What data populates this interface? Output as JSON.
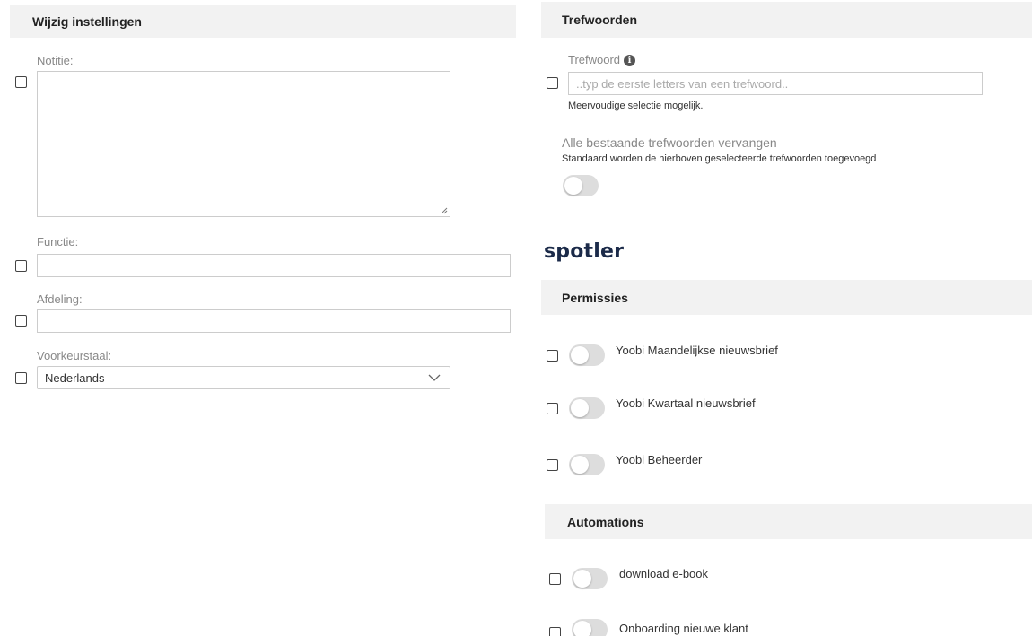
{
  "left": {
    "header": "Wijzig instellingen",
    "notitie": {
      "label": "Notitie:",
      "value": ""
    },
    "functie": {
      "label": "Functie:",
      "value": ""
    },
    "afdeling": {
      "label": "Afdeling:",
      "value": ""
    },
    "voorkeurstaal": {
      "label": "Voorkeurstaal:",
      "selected": "Nederlands"
    }
  },
  "right": {
    "trefwoorden": {
      "header": "Trefwoorden",
      "label": "Trefwoord",
      "placeholder": "..typ de eerste letters van een trefwoord..",
      "help": "Meervoudige selectie mogelijk.",
      "replace_label": "Alle bestaande trefwoorden vervangen",
      "replace_help": "Standaard worden de hierboven geselecteerde trefwoorden toegevoegd",
      "replace_on": false
    },
    "logo": "spotler",
    "permissies": {
      "header": "Permissies",
      "items": [
        {
          "label": "Yoobi Maandelijkse nieuwsbrief",
          "on": false
        },
        {
          "label": "Yoobi Kwartaal nieuwsbrief",
          "on": false
        },
        {
          "label": "Yoobi Beheerder",
          "on": false
        }
      ]
    },
    "automations": {
      "header": "Automations",
      "items": [
        {
          "label": "download e-book",
          "on": false
        },
        {
          "label": "Onboarding nieuwe klant",
          "on": false
        }
      ]
    }
  },
  "colors": {
    "header_bg": "#f2f2f2",
    "toggle_off": "#dddddd",
    "logo": "#1b2a49"
  }
}
